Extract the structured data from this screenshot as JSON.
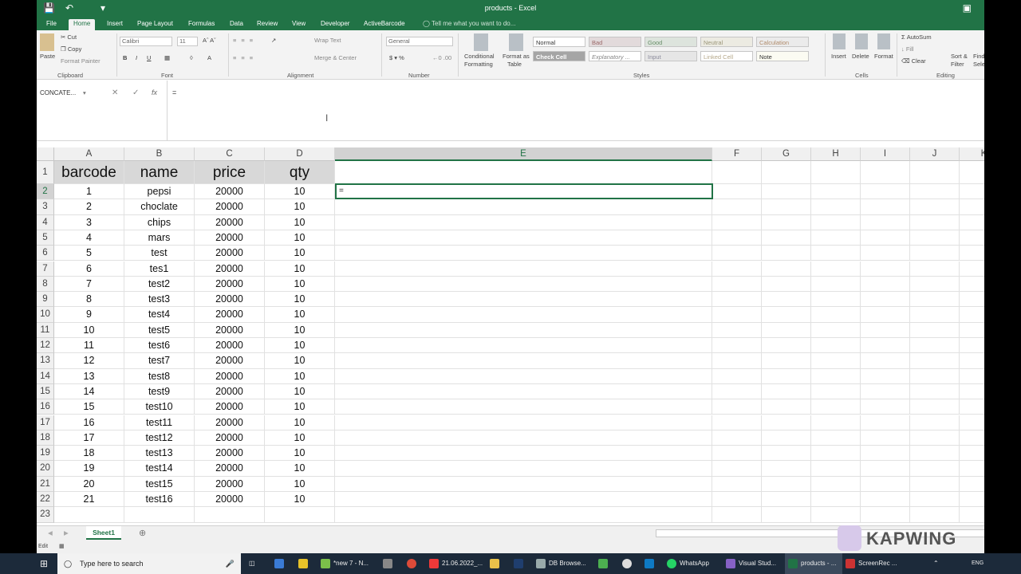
{
  "window_title": "products - Excel",
  "ribbon_tabs": [
    "File",
    "Home",
    "Insert",
    "Page Layout",
    "Formulas",
    "Data",
    "Review",
    "View",
    "Developer",
    "ActiveBarcode"
  ],
  "tell_me": "Tell me what you want to do...",
  "clipboard": {
    "paste": "Paste",
    "cut": "Cut",
    "copy": "Copy",
    "format_painter": "Format Painter",
    "label": "Clipboard"
  },
  "font": {
    "name": "Calibri",
    "size": "11",
    "label": "Font"
  },
  "alignment": {
    "wrap": "Wrap Text",
    "merge": "Merge & Center",
    "label": "Alignment"
  },
  "number": {
    "format": "General",
    "label": "Number"
  },
  "styles": {
    "conditional": "Conditional",
    "formatting": "Formatting",
    "format_as": "Format as",
    "table": "Table",
    "label": "Styles",
    "cells": [
      "Normal",
      "Bad",
      "Good",
      "Neutral",
      "Calculation",
      "Check Cell",
      "Explanatory ...",
      "Input",
      "Linked Cell",
      "Note"
    ]
  },
  "cells_group": {
    "insert": "Insert",
    "delete": "Delete",
    "format": "Format",
    "label": "Cells"
  },
  "editing": {
    "autosum": "AutoSum",
    "fill": "Fill",
    "clear": "Clear",
    "sort": "Sort &",
    "filter": "Filter",
    "find": "Find",
    "select": "Sele",
    "label": "Editing"
  },
  "formula_bar": {
    "name_box": "CONCATE...",
    "content": "="
  },
  "columns": [
    "A",
    "B",
    "C",
    "D",
    "E",
    "F",
    "G",
    "H",
    "I",
    "J",
    "K"
  ],
  "table": {
    "headers": [
      "barcode",
      "name",
      "price",
      "qty"
    ],
    "rows": [
      [
        "1",
        "pepsi",
        "20000",
        "10"
      ],
      [
        "2",
        "choclate",
        "20000",
        "10"
      ],
      [
        "3",
        "chips",
        "20000",
        "10"
      ],
      [
        "4",
        "mars",
        "20000",
        "10"
      ],
      [
        "5",
        "test",
        "20000",
        "10"
      ],
      [
        "6",
        "tes1",
        "20000",
        "10"
      ],
      [
        "7",
        "test2",
        "20000",
        "10"
      ],
      [
        "8",
        "test3",
        "20000",
        "10"
      ],
      [
        "9",
        "test4",
        "20000",
        "10"
      ],
      [
        "10",
        "test5",
        "20000",
        "10"
      ],
      [
        "11",
        "test6",
        "20000",
        "10"
      ],
      [
        "12",
        "test7",
        "20000",
        "10"
      ],
      [
        "13",
        "test8",
        "20000",
        "10"
      ],
      [
        "14",
        "test9",
        "20000",
        "10"
      ],
      [
        "15",
        "test10",
        "20000",
        "10"
      ],
      [
        "16",
        "test11",
        "20000",
        "10"
      ],
      [
        "17",
        "test12",
        "20000",
        "10"
      ],
      [
        "18",
        "test13",
        "20000",
        "10"
      ],
      [
        "19",
        "test14",
        "20000",
        "10"
      ],
      [
        "20",
        "test15",
        "20000",
        "10"
      ],
      [
        "21",
        "test16",
        "20000",
        "10"
      ]
    ]
  },
  "active_cell": {
    "ref": "E2",
    "value": "="
  },
  "row_numbers": [
    "1",
    "2",
    "3",
    "4",
    "5",
    "6",
    "7",
    "8",
    "9",
    "10",
    "11",
    "12",
    "13",
    "14",
    "15",
    "16",
    "17",
    "18",
    "19",
    "20",
    "21",
    "22",
    "23"
  ],
  "sheet_tab": "Sheet1",
  "status": "Edit",
  "taskbar": {
    "search": "Type here to search",
    "items": [
      "*new 7 - N...",
      "21.06.2022_...",
      "DB Browse...",
      "WhatsApp",
      "Visual Stud...",
      "products - ...",
      "ScreenRec ..."
    ],
    "lang": "ENG"
  },
  "watermark": "KAPWING",
  "colors": {
    "accent": "#217346",
    "taskbar": "#1c2a3a"
  }
}
